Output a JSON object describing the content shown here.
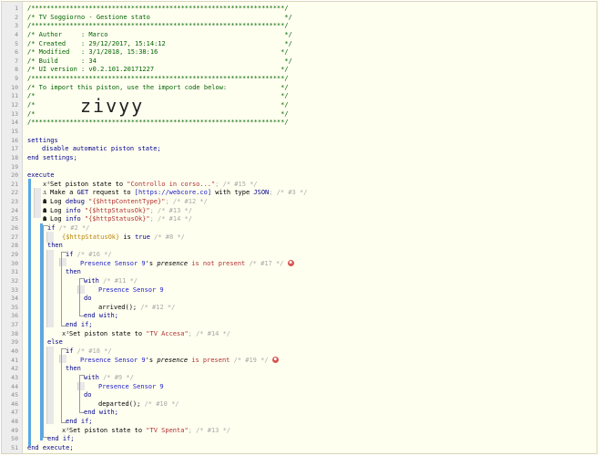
{
  "gutter_numbers": [
    "1",
    "2",
    "3",
    "4",
    "5",
    "6",
    "7",
    "8",
    "9",
    "10",
    "11",
    "12",
    "13",
    "14",
    "15",
    "16",
    "17",
    "18",
    "19",
    "20",
    "21",
    "22",
    "23",
    "24",
    "25",
    "26",
    "27",
    "28",
    "29",
    "30",
    "31",
    "32",
    "33",
    "34",
    "35",
    "36",
    "37",
    "38",
    "39",
    "40",
    "41",
    "42",
    "43",
    "44",
    "45",
    "46",
    "47",
    "48",
    "49",
    "50",
    "51"
  ],
  "header": {
    "stars": "/******************************************************************/",
    "title": "/* TV Soggiorno - Gestione stato                                   */",
    "author": "/* Author     : Marco                                              */",
    "created": "/* Created    : 29/12/2017, 15:14:12                               */",
    "modified": "/* Modified   : 3/1/2018, 15:38:16                                */",
    "build": "/* Build      : 34                                                 */",
    "ui_version": "/* UI version : v0.2.101.20171227                                 */",
    "import_note": "/* To import this piston, use the import code below:              */",
    "empty": "/*                                                                */",
    "import_code": "zivyy"
  },
  "code": {
    "settings": "settings",
    "disable": "disable automatic piston state;",
    "end_settings": "end settings;",
    "execute": "execute",
    "l21_pre": "Set piston state to ",
    "l21_str": "\"Controllo in corso...\"",
    "l21_cm": "; /* #15 */",
    "l22_pre": "Make a ",
    "l22_get": "GET",
    "l22_mid": " request to ",
    "l22_url": "[https://webcore.co]",
    "l22_type": " with type ",
    "l22_json": "JSON",
    "l22_cm": "; /* #3 */",
    "l23_pre": "Log ",
    "l23_lvl": "debug",
    "l23_str": "\"{$httpContentType}\"",
    "l23_cm": "; /* #12 */",
    "l24_lvl": "info",
    "l24_str": "\"{$httpStatusOk}\"",
    "l24_cm": "; /* #13 */",
    "l25_cm": "; /* #14 */",
    "if": "if",
    "then": "then",
    "else": "else",
    "end_if": "end if;",
    "do": "do",
    "with": "with",
    "end_with": "end with;",
    "c26": "/* #2 */",
    "l27_var": "{$httpStatusOk}",
    "l27_is": " is ",
    "l27_true": "true",
    "l27_cm": " /* #8 */",
    "c29": "/* #16 */",
    "device": "Presence Sensor 9",
    "apos": "'s ",
    "presence": "presence",
    "l30_op": " is not present",
    "l30_cm": " /* #17 */",
    "c32": "/* #11 */",
    "arrived": "arrived();",
    "c35": " /* #12 */",
    "l38_str": "\"TV Accesa\"",
    "l38_cm": "; /* #14 */",
    "c40": "/* #18 */",
    "l41_op": " is present",
    "l41_cm": " /* #19 */",
    "c43": "/* #9 */",
    "departed": "departed();",
    "c46": " /* #10 */",
    "l49_str": "\"TV Spenta\"",
    "l49_cm": "; /* #13 */",
    "end_execute": "end execute;"
  },
  "icons": {
    "x2": "x²",
    "anchor": "anchor-icon",
    "log": "log-icon",
    "trace": "trace-icon"
  },
  "colors": {
    "background": "#fffff0",
    "bar": "#58a8e6",
    "header_text": "#006400",
    "string": "#b03030",
    "device": "#2020c8",
    "trace": "#d9534f"
  }
}
